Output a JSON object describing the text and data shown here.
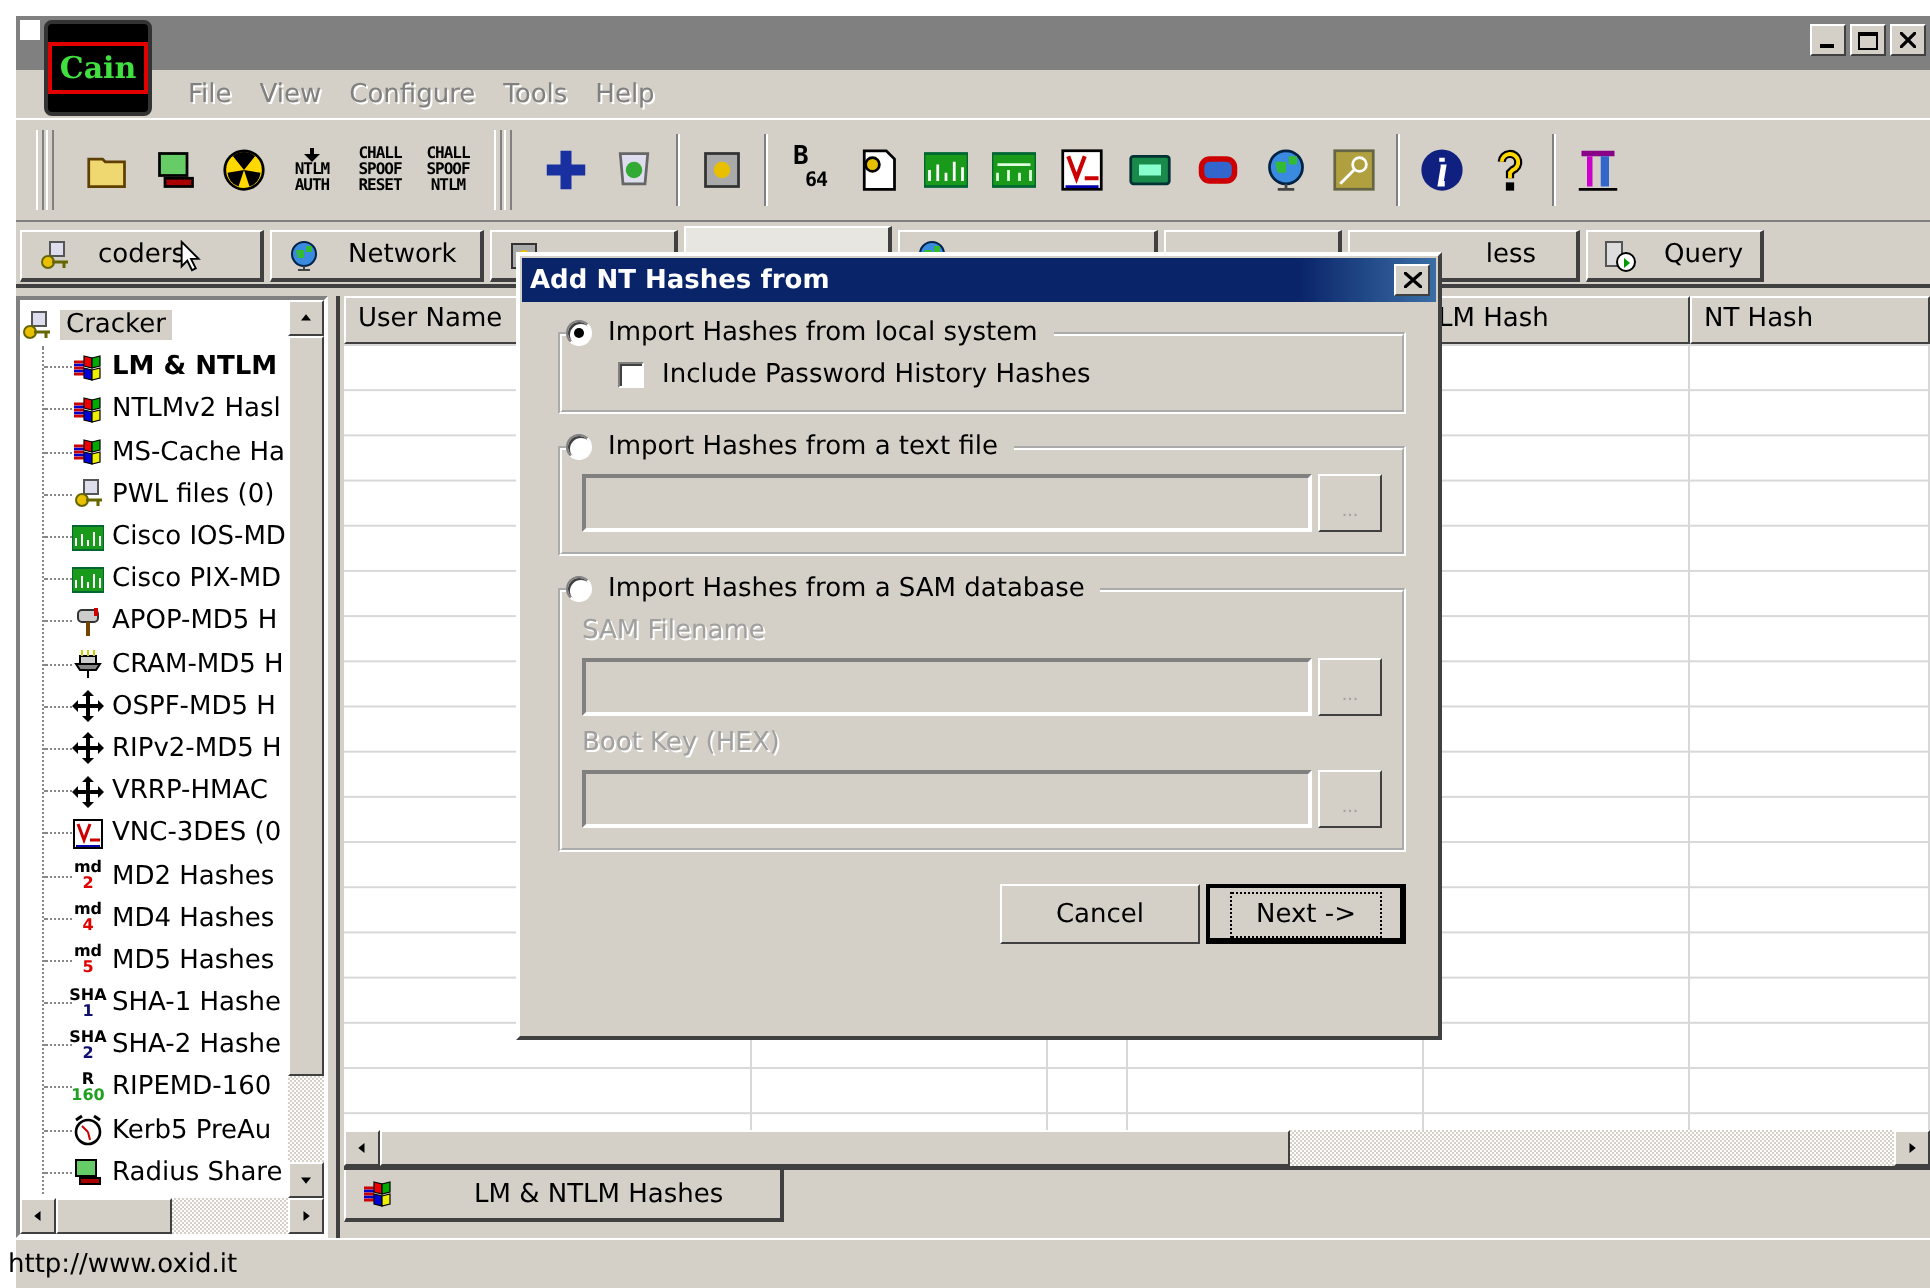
{
  "window": {
    "logo": "Cain",
    "menu": [
      {
        "label": "File",
        "disabled": true
      },
      {
        "label": "View",
        "disabled": true
      },
      {
        "label": "Configure",
        "disabled": true
      },
      {
        "label": "Tools",
        "disabled": true
      },
      {
        "label": "Help",
        "disabled": true
      }
    ]
  },
  "toolbar": [
    {
      "kind": "grip"
    },
    {
      "kind": "button"
    },
    {
      "kind": "button"
    },
    {
      "kind": "button"
    },
    {
      "kind": "caption",
      "lines": [
        "NTLM",
        "AUTH"
      ]
    },
    {
      "kind": "caption",
      "lines": [
        "CHALL",
        "SPOOF",
        "RESET"
      ]
    },
    {
      "kind": "caption",
      "lines": [
        "CHALL",
        "SPOOF",
        "NTLM"
      ]
    },
    {
      "kind": "grip"
    },
    {
      "kind": "button"
    },
    {
      "kind": "button"
    },
    {
      "kind": "separator"
    },
    {
      "kind": "button"
    },
    {
      "kind": "separator"
    },
    {
      "kind": "caption",
      "lines": [
        "B",
        "64"
      ]
    },
    {
      "kind": "button"
    },
    {
      "kind": "button"
    },
    {
      "kind": "button"
    },
    {
      "kind": "button"
    },
    {
      "kind": "button"
    },
    {
      "kind": "button"
    },
    {
      "kind": "button"
    },
    {
      "kind": "button"
    },
    {
      "kind": "separator"
    },
    {
      "kind": "button"
    },
    {
      "kind": "button"
    },
    {
      "kind": "separator"
    },
    {
      "kind": "button"
    }
  ],
  "tabs": [
    {
      "label": "coders",
      "selected": false
    },
    {
      "label": "Network",
      "selected": false
    },
    {
      "selected": false
    },
    {
      "selected": true
    },
    {
      "selected": false
    },
    {
      "selected": false
    },
    {
      "label": "less",
      "selected": false
    },
    {
      "label": "Query",
      "selected": false
    }
  ],
  "tree": {
    "label": "Cracker",
    "selected": true,
    "children": [
      {
        "label": "LM & NTLM",
        "current": true
      },
      {
        "label": "NTLMv2 Hasl",
        "current": false
      },
      {
        "label": "MS-Cache Ha",
        "current": false
      },
      {
        "label": "PWL files (0)",
        "current": false
      },
      {
        "label": "Cisco IOS-MD",
        "current": false
      },
      {
        "label": "Cisco PIX-MD",
        "current": false
      },
      {
        "label": "APOP-MD5 H",
        "current": false
      },
      {
        "label": "CRAM-MD5 H",
        "current": false
      },
      {
        "label": "OSPF-MD5 H",
        "current": false
      },
      {
        "label": "RIPv2-MD5 H",
        "current": false
      },
      {
        "label": "VRRP-HMAC",
        "current": false
      },
      {
        "label": "VNC-3DES (0",
        "current": false
      },
      {
        "label": "MD2 Hashes",
        "icon_text": [
          "md",
          "2"
        ],
        "current": false
      },
      {
        "label": "MD4 Hashes",
        "icon_text": [
          "md",
          "4"
        ],
        "current": false
      },
      {
        "label": "MD5 Hashes",
        "icon_text": [
          "md",
          "5"
        ],
        "current": false
      },
      {
        "label": "SHA-1 Hashe",
        "icon_text": [
          "SHA",
          "1"
        ],
        "current": false
      },
      {
        "label": "SHA-2 Hashe",
        "icon_text": [
          "SHA",
          "2"
        ],
        "current": false
      },
      {
        "label": "RIPEMD-160",
        "icon_text": [
          "R",
          "160"
        ],
        "current": false
      },
      {
        "label": "Kerb5 PreAu",
        "current": false
      },
      {
        "label": "Radius Share",
        "current": false
      }
    ]
  },
  "table": {
    "columns": [
      {
        "label": "User Name"
      },
      {
        "label": "LM Hash"
      },
      {
        "label": "NT Hash"
      }
    ]
  },
  "bottom_tab": {
    "label": "LM & NTLM Hashes"
  },
  "status_bar": "http://www.oxid.it",
  "dialog": {
    "title": "Add NT Hashes from",
    "groups": [
      {
        "label": "Import Hashes from local system",
        "selected": true,
        "items": [
          {
            "kind": "checkbox",
            "label": "Include Password History Hashes",
            "checked": false
          }
        ]
      },
      {
        "label": "Import Hashes from a text file",
        "selected": false,
        "items": [
          {
            "kind": "field",
            "disabled": true,
            "browse": "..."
          }
        ]
      },
      {
        "label": "Import Hashes from a SAM database",
        "selected": false,
        "items": [
          {
            "kind": "label",
            "label": "SAM Filename",
            "disabled": true
          },
          {
            "kind": "field",
            "disabled": true,
            "browse": "..."
          },
          {
            "kind": "label",
            "label": "Boot Key (HEX)",
            "disabled": true
          },
          {
            "kind": "field",
            "disabled": true,
            "browse": "..."
          }
        ]
      }
    ],
    "buttons": [
      {
        "label": "Cancel",
        "default": false
      },
      {
        "label": "Next ->",
        "default": true
      }
    ]
  }
}
